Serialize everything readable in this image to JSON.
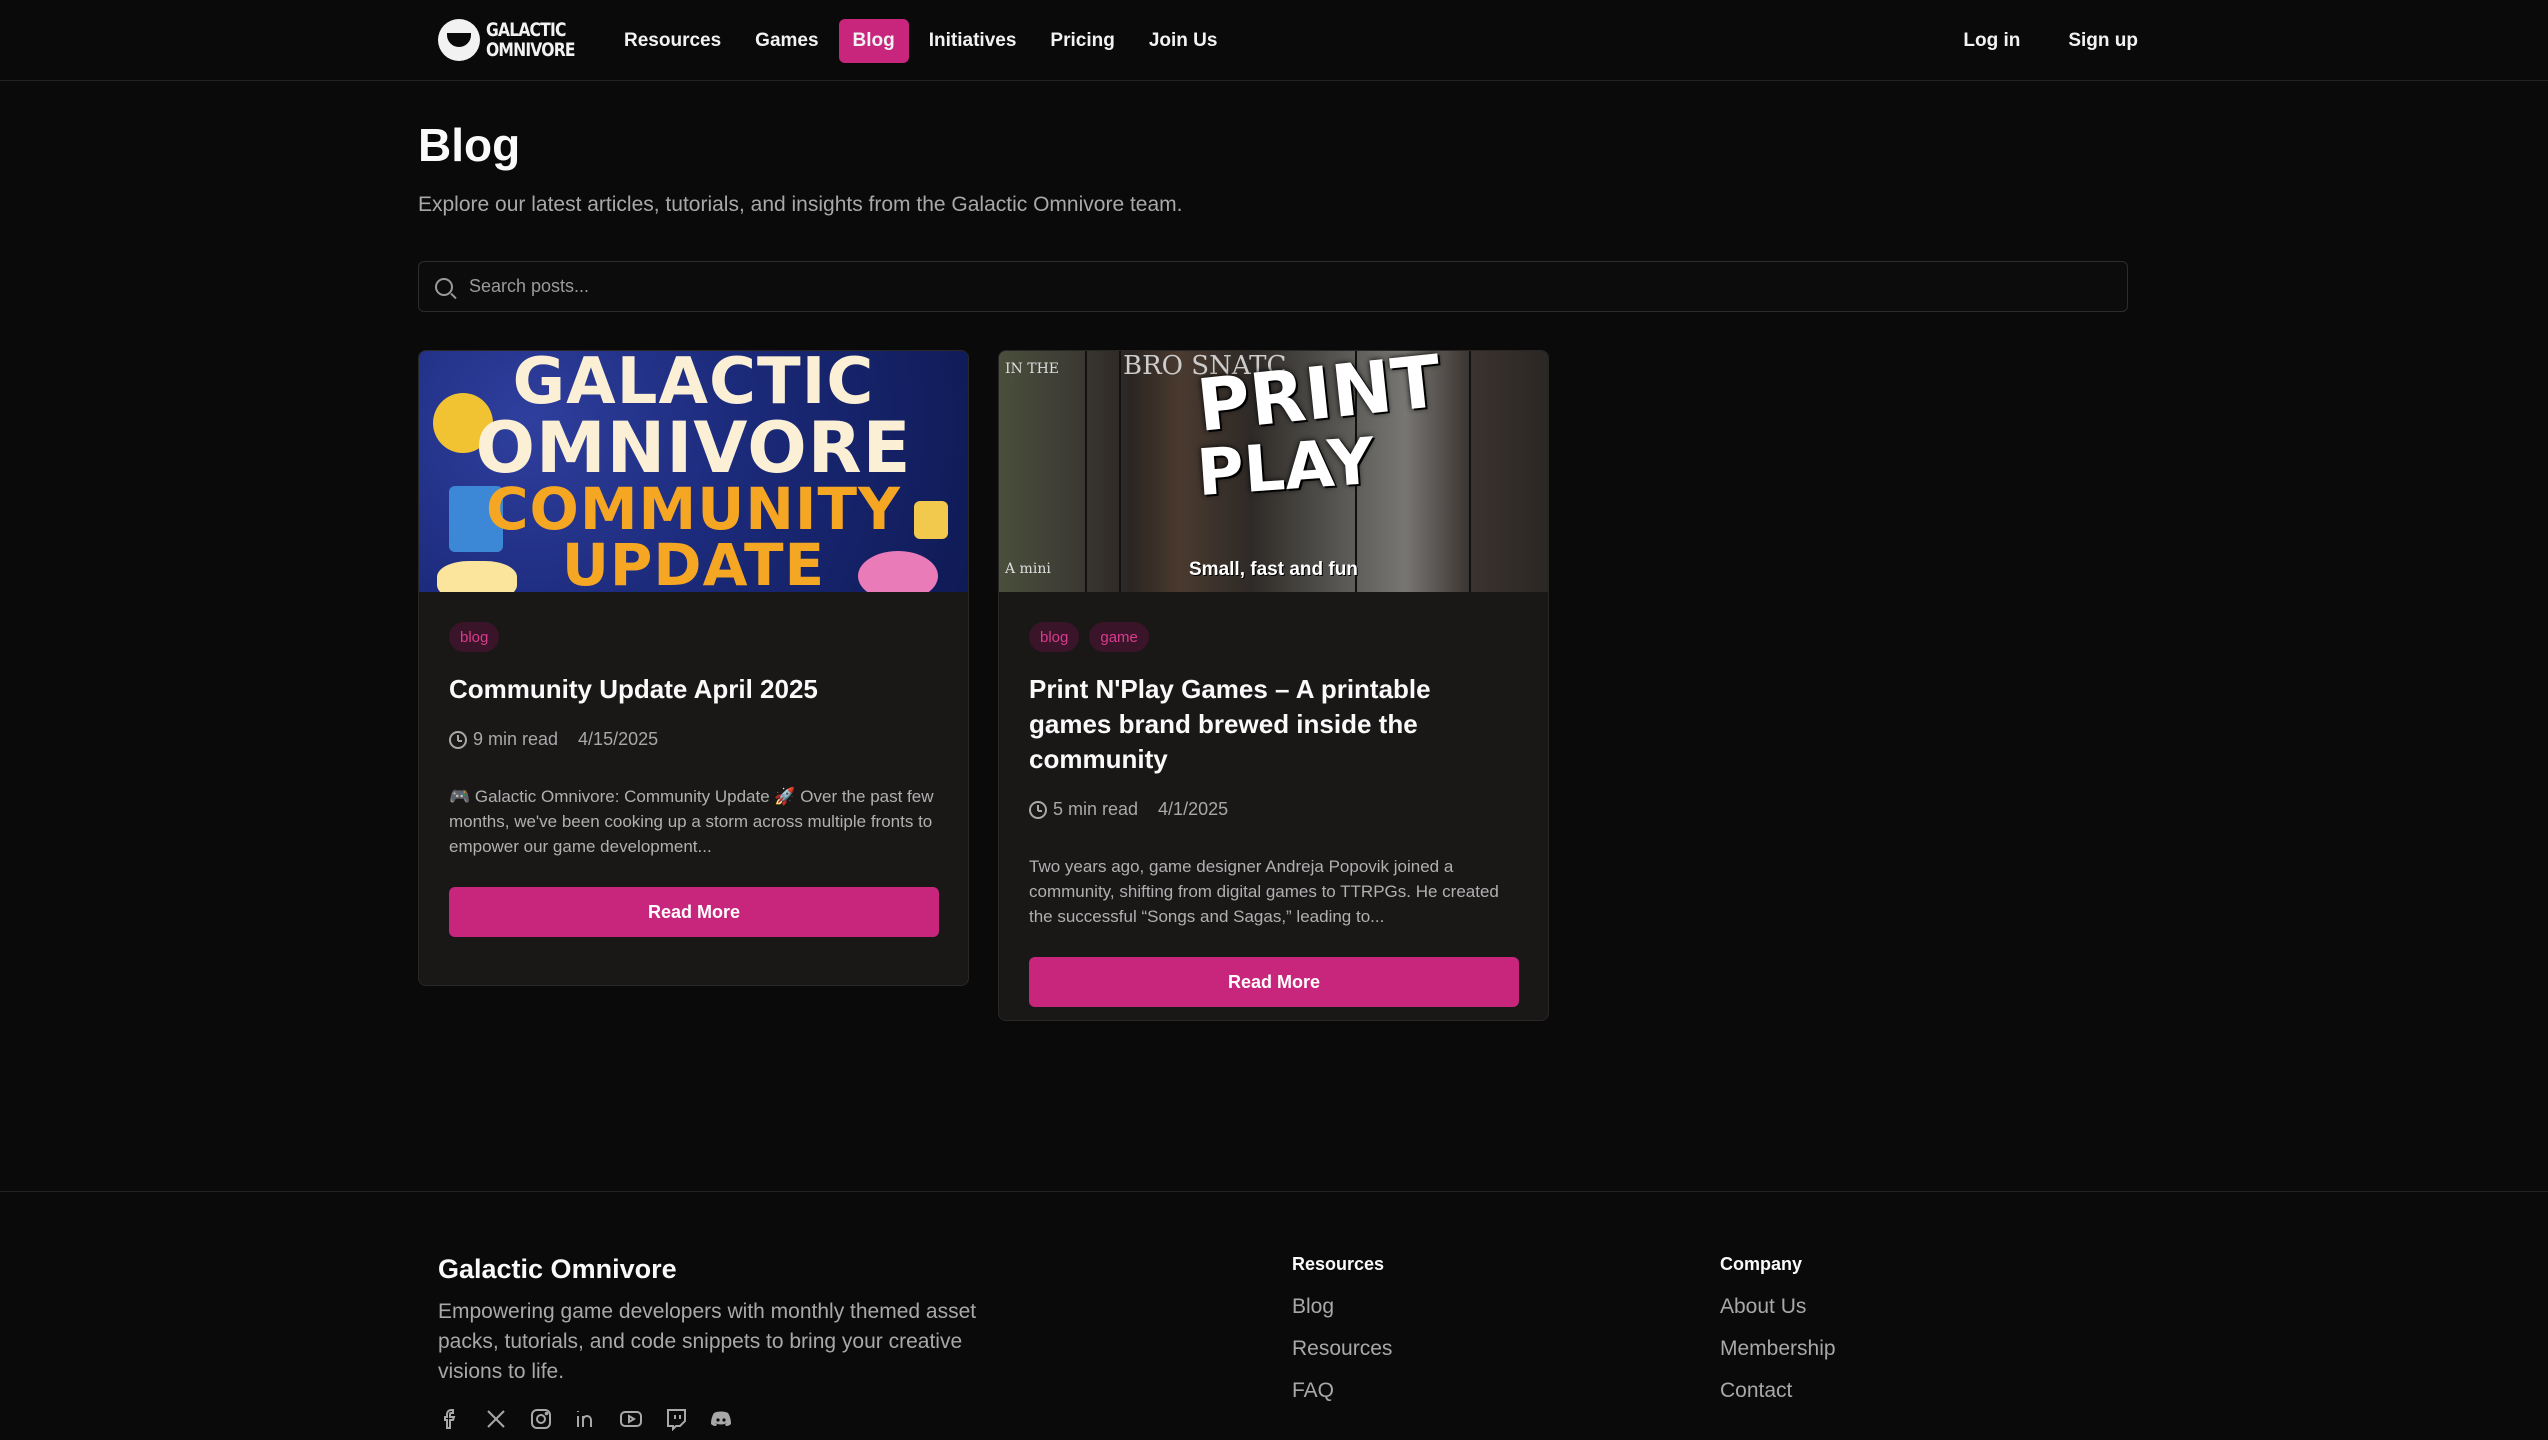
{
  "header": {
    "logo_text": "GALACTIC OMNIVORE",
    "nav": [
      {
        "label": "Resources",
        "active": false
      },
      {
        "label": "Games",
        "active": false
      },
      {
        "label": "Blog",
        "active": true
      },
      {
        "label": "Initiatives",
        "active": false
      },
      {
        "label": "Pricing",
        "active": false
      },
      {
        "label": "Join Us",
        "active": false
      }
    ],
    "login_label": "Log in",
    "signup_label": "Sign up"
  },
  "page": {
    "title": "Blog",
    "subtitle": "Explore our latest articles, tutorials, and insights from the Galactic Omnivore team.",
    "search_placeholder": "Search posts...",
    "search_value": ""
  },
  "posts": [
    {
      "image": {
        "line1": "GALACTIC",
        "line2": "OMNIVORE",
        "line3": "COMMUNITY",
        "line4": "UPDATE"
      },
      "tags": [
        "blog"
      ],
      "title": "Community Update April 2025",
      "read_time": "9 min read",
      "date": "4/15/2025",
      "excerpt": "🎮 Galactic Omnivore: Community Update 🚀 Over the past few months, we've been cooking up a storm across multiple fronts to empower our game development...",
      "button_label": "Read More"
    },
    {
      "image": {
        "line1": "PRINT",
        "line2": "PLAY",
        "tagline": "Small, fast and fun",
        "side_left": "IN THE",
        "side_top": "BRO SNATC",
        "side_bottom": "A mini"
      },
      "tags": [
        "blog",
        "game"
      ],
      "title": "Print N'Play Games – A printable games brand brewed inside the community",
      "read_time": "5 min read",
      "date": "4/1/2025",
      "excerpt": "Two years ago, game designer Andreja Popovik joined a community, shifting from digital games to TTRPGs. He created the successful “Songs and Sagas,” leading to...",
      "button_label": "Read More"
    }
  ],
  "footer": {
    "brand": "Galactic Omnivore",
    "description": "Empowering game developers with monthly themed asset packs, tutorials, and code snippets to bring your creative visions to life.",
    "socials": [
      "facebook-icon",
      "x-icon",
      "instagram-icon",
      "linkedin-icon",
      "youtube-icon",
      "twitch-icon",
      "discord-icon"
    ],
    "columns": [
      {
        "title": "Resources",
        "links": [
          "Blog",
          "Resources",
          "FAQ"
        ]
      },
      {
        "title": "Company",
        "links": [
          "About Us",
          "Membership",
          "Contact"
        ]
      }
    ]
  },
  "colors": {
    "accent": "#c8267d",
    "background": "#0b0a0a",
    "card": "#1a1717",
    "tag_bg": "#3a1429",
    "tag_text": "#d83c8e"
  }
}
